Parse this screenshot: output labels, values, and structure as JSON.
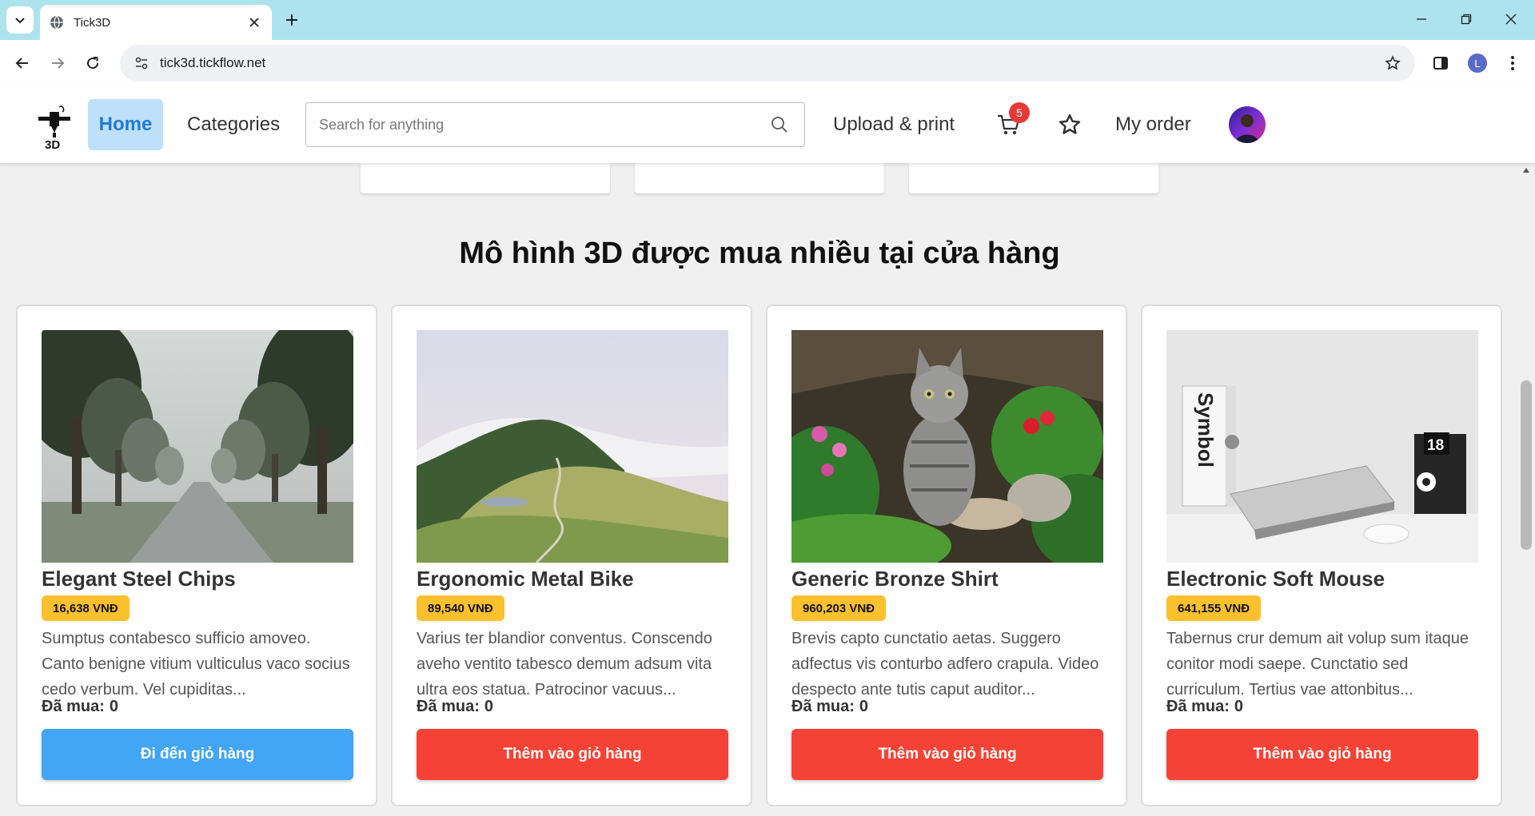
{
  "browser": {
    "tab_title": "Tick3D",
    "url": "tick3d.tickflow.net",
    "profile_initial": "L"
  },
  "header": {
    "home_label": "Home",
    "categories_label": "Categories",
    "search_placeholder": "Search for anything",
    "upload_label": "Upload & print",
    "cart_count": "5",
    "my_order_label": "My order"
  },
  "section": {
    "title": "Mô hình 3D được mua nhiều tại cửa hàng"
  },
  "products": [
    {
      "name": "Elegant Steel Chips",
      "price": "16,638 VNĐ",
      "description": "Sumptus contabesco sufficio amoveo. Canto benigne vitium vulticulus vaco socius cedo verbum. Vel cupiditas...",
      "sold_label": "Đã mua:",
      "sold_count": "0",
      "button_label": "Đi đến giỏ hàng",
      "image": "foggy-tree-lined-road"
    },
    {
      "name": "Ergonomic Metal Bike",
      "price": "89,540 VNĐ",
      "description": "Varius ter blandior conventus. Conscendo aveho ventito tabesco demum adsum vita ultra eos statua. Patrocinor vacuus...",
      "sold_label": "Đã mua:",
      "sold_count": "0",
      "button_label": "Thêm vào giỏ hàng",
      "image": "green-hills-winding-road"
    },
    {
      "name": "Generic Bronze Shirt",
      "price": "960,203 VNĐ",
      "description": "Brevis capto cunctatio aetas. Suggero adfectus vis conturbo adfero crapula. Video despecto ante tutis caput auditor...",
      "sold_label": "Đã mua:",
      "sold_count": "0",
      "button_label": "Thêm vào giỏ hàng",
      "image": "tabby-kitten-in-flowers"
    },
    {
      "name": "Electronic Soft Mouse",
      "price": "641,155 VNĐ",
      "description": "Tabernus crur demum ait volup sum itaque conitor modi saepe. Cunctatio sed curriculum. Tertius vae attonbitus...",
      "sold_label": "Đã mua:",
      "sold_count": "0",
      "button_label": "Thêm vào giỏ hàng",
      "image": "laptop-desk-still-life"
    }
  ],
  "photo_text": {
    "book_spine": "Symbol",
    "calendar_day": "18"
  },
  "colors": {
    "tabbar": "#ade3ee",
    "home_active_bg": "#bfe0fb",
    "home_active_text": "#1e7ad6",
    "price_badge": "#fbc02d",
    "primary_button": "#42a5f5",
    "add_button": "#f44336",
    "cart_badge": "#e53935"
  }
}
